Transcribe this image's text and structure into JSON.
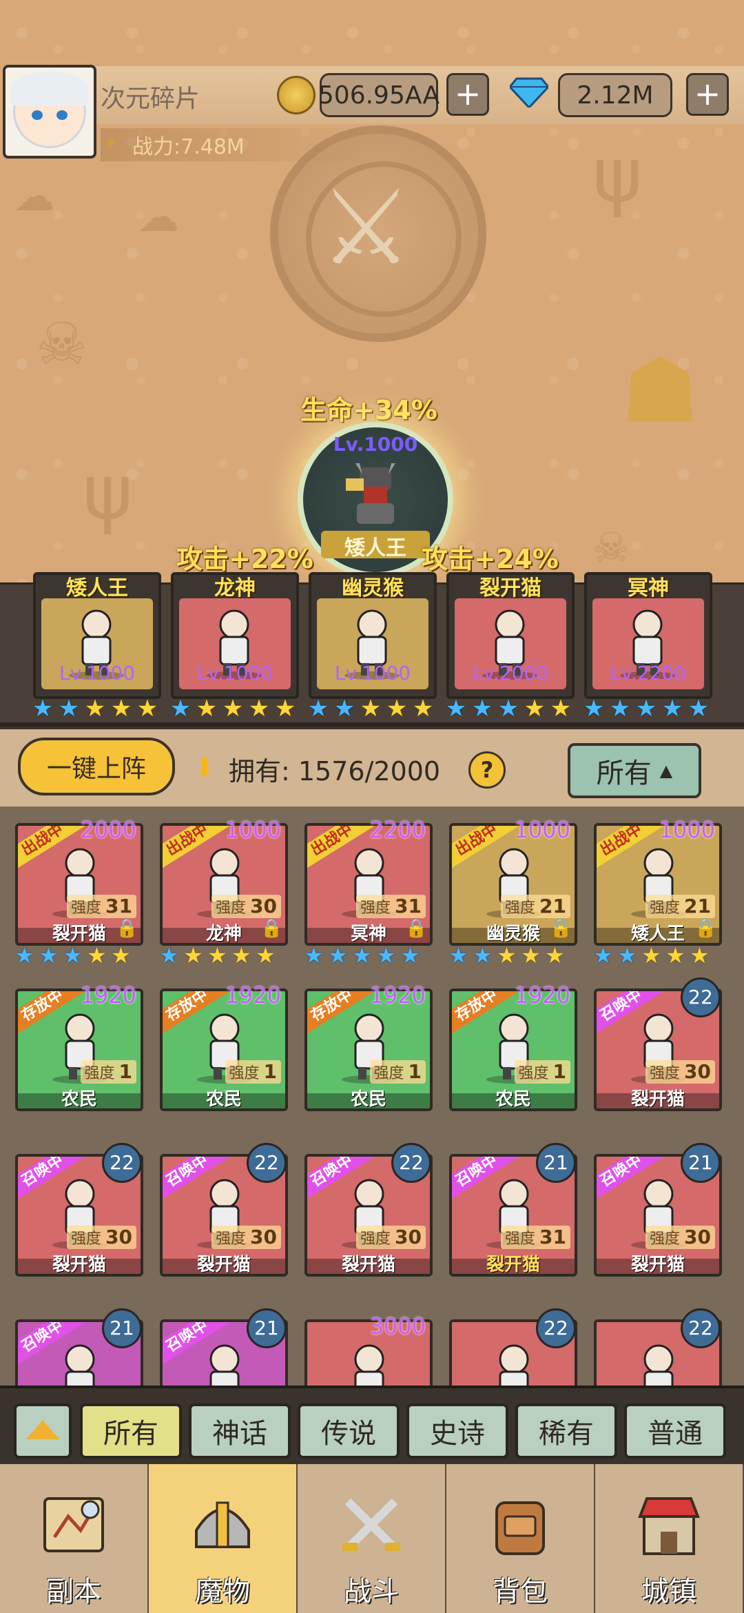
{
  "player": {
    "name": "次元碎片",
    "power": "战力:7.48M",
    "gold": "506.95AA",
    "gems": "2.12M",
    "plus": "+"
  },
  "leader": {
    "bonus": "生命+34%",
    "level": "Lv.1000",
    "name": "矮人王"
  },
  "side_bonuses": [
    "攻击+22%",
    "攻击+24%"
  ],
  "team": [
    {
      "name": "矮人王",
      "level": "Lv.1000",
      "color": "#c9a65a",
      "stars": [
        "blue",
        "blue",
        "gold",
        "gold",
        "gold"
      ]
    },
    {
      "name": "龙神",
      "level": "Lv.1000",
      "color": "#d46a6a",
      "stars": [
        "blue",
        "gold",
        "gold",
        "gold",
        "gold"
      ]
    },
    {
      "name": "幽灵猴",
      "level": "Lv.1000",
      "color": "#c9a65a",
      "stars": [
        "blue",
        "blue",
        "gold",
        "gold",
        "gold"
      ]
    },
    {
      "name": "裂开猫",
      "level": "Lv.2000",
      "color": "#d46a6a",
      "stars": [
        "blue",
        "blue",
        "blue",
        "gold",
        "gold"
      ]
    },
    {
      "name": "冥神",
      "level": "Lv.2200",
      "color": "#d46a6a",
      "stars": [
        "blue",
        "blue",
        "blue",
        "blue",
        "blue"
      ]
    }
  ],
  "controls": {
    "auto_deploy": "一键上阵",
    "owned": "拥有: 1576/2000",
    "help": "?",
    "filter": "所有"
  },
  "cards": [
    {
      "tag": "出战中",
      "tag_type": "out",
      "count": "2000",
      "wide": true,
      "strength_label": "强度",
      "strength": "31",
      "name": "裂开猫",
      "lock": true,
      "color": "#d46a6a",
      "name_gold": false
    },
    {
      "tag": "出战中",
      "tag_type": "out",
      "count": "1000",
      "wide": true,
      "strength_label": "强度",
      "strength": "30",
      "name": "龙神",
      "lock": true,
      "color": "#d46a6a",
      "name_gold": false
    },
    {
      "tag": "出战中",
      "tag_type": "out",
      "count": "2200",
      "wide": true,
      "strength_label": "强度",
      "strength": "31",
      "name": "冥神",
      "lock": true,
      "color": "#d46a6a",
      "name_gold": false
    },
    {
      "tag": "出战中",
      "tag_type": "out",
      "count": "1000",
      "wide": true,
      "strength_label": "强度",
      "strength": "21",
      "name": "幽灵猴",
      "lock": true,
      "color": "#c9a65a",
      "name_gold": false
    },
    {
      "tag": "出战中",
      "tag_type": "out",
      "count": "1000",
      "wide": true,
      "strength_label": "强度",
      "strength": "21",
      "name": "矮人王",
      "lock": true,
      "color": "#c9a65a",
      "name_gold": false
    },
    {
      "tag": "存放中",
      "tag_type": "store",
      "count": "1920",
      "wide": true,
      "strength_label": "强度",
      "strength": "1",
      "name": "农民",
      "lock": false,
      "color": "#5fbf6a",
      "name_gold": false
    },
    {
      "tag": "存放中",
      "tag_type": "store",
      "count": "1920",
      "wide": true,
      "strength_label": "强度",
      "strength": "1",
      "name": "农民",
      "lock": false,
      "color": "#5fbf6a",
      "name_gold": false
    },
    {
      "tag": "存放中",
      "tag_type": "store",
      "count": "1920",
      "wide": true,
      "strength_label": "强度",
      "strength": "1",
      "name": "农民",
      "lock": false,
      "color": "#5fbf6a",
      "name_gold": false
    },
    {
      "tag": "存放中",
      "tag_type": "store",
      "count": "1920",
      "wide": true,
      "strength_label": "强度",
      "strength": "1",
      "name": "农民",
      "lock": false,
      "color": "#5fbf6a",
      "name_gold": false
    },
    {
      "tag": "召唤中",
      "tag_type": "summon",
      "count": "22",
      "wide": false,
      "strength_label": "强度",
      "strength": "30",
      "name": "裂开猫",
      "lock": false,
      "color": "#d46a6a",
      "name_gold": false
    },
    {
      "tag": "召唤中",
      "tag_type": "summon",
      "count": "22",
      "wide": false,
      "strength_label": "强度",
      "strength": "30",
      "name": "裂开猫",
      "lock": false,
      "color": "#d46a6a",
      "name_gold": false
    },
    {
      "tag": "召唤中",
      "tag_type": "summon",
      "count": "22",
      "wide": false,
      "strength_label": "强度",
      "strength": "30",
      "name": "裂开猫",
      "lock": false,
      "color": "#d46a6a",
      "name_gold": false
    },
    {
      "tag": "召唤中",
      "tag_type": "summon",
      "count": "22",
      "wide": false,
      "strength_label": "强度",
      "strength": "30",
      "name": "裂开猫",
      "lock": false,
      "color": "#d46a6a",
      "name_gold": false
    },
    {
      "tag": "召唤中",
      "tag_type": "summon",
      "count": "21",
      "wide": false,
      "strength_label": "强度",
      "strength": "31",
      "name": "裂开猫",
      "lock": false,
      "color": "#d46a6a",
      "name_gold": true
    },
    {
      "tag": "召唤中",
      "tag_type": "summon",
      "count": "21",
      "wide": false,
      "strength_label": "强度",
      "strength": "30",
      "name": "裂开猫",
      "lock": false,
      "color": "#d46a6a",
      "name_gold": false
    },
    {
      "tag": "召唤中",
      "tag_type": "summon",
      "count": "21",
      "wide": false,
      "strength_label": "",
      "strength": "",
      "name": "",
      "lock": false,
      "color": "#c45ab8",
      "name_gold": false
    },
    {
      "tag": "召唤中",
      "tag_type": "summon",
      "count": "21",
      "wide": false,
      "strength_label": "",
      "strength": "",
      "name": "",
      "lock": false,
      "color": "#c45ab8",
      "name_gold": false
    },
    {
      "tag": "",
      "tag_type": "",
      "count": "3000",
      "wide": true,
      "strength_label": "",
      "strength": "",
      "name": "",
      "lock": false,
      "color": "#d46a6a",
      "name_gold": false
    },
    {
      "tag": "",
      "tag_type": "",
      "count": "22",
      "wide": false,
      "strength_label": "",
      "strength": "",
      "name": "",
      "lock": false,
      "color": "#d46a6a",
      "name_gold": false
    },
    {
      "tag": "",
      "tag_type": "",
      "count": "22",
      "wide": false,
      "strength_label": "",
      "strength": "",
      "name": "",
      "lock": false,
      "color": "#d46a6a",
      "name_gold": false
    }
  ],
  "card_star_rows": [
    [
      "blue",
      "blue",
      "blue",
      "gold",
      "gold"
    ],
    [
      "blue",
      "gold",
      "gold",
      "gold",
      "gold"
    ],
    [
      "blue",
      "blue",
      "blue",
      "blue",
      "blue"
    ],
    [
      "blue",
      "blue",
      "gold",
      "gold",
      "gold"
    ],
    [
      "blue",
      "blue",
      "gold",
      "gold",
      "gold"
    ]
  ],
  "categories": [
    "所有",
    "神话",
    "传说",
    "史诗",
    "稀有",
    "普通"
  ],
  "nav": [
    {
      "label": "副本",
      "icon": "map-icon"
    },
    {
      "label": "魔物",
      "icon": "helmet-icon"
    },
    {
      "label": "战斗",
      "icon": "crossed-swords-icon"
    },
    {
      "label": "背包",
      "icon": "backpack-icon"
    },
    {
      "label": "城镇",
      "icon": "shop-icon"
    }
  ]
}
